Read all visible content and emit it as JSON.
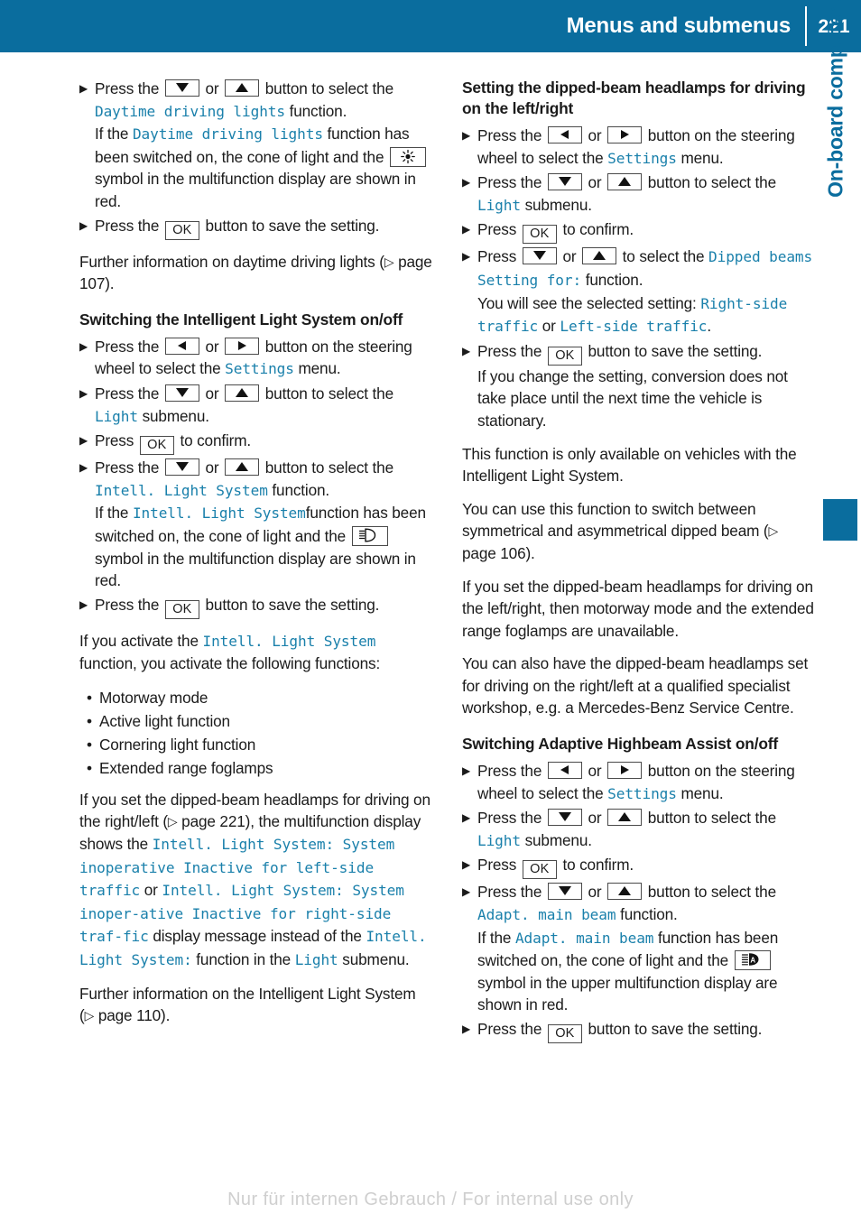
{
  "header": {
    "title": "Menus and submenus",
    "page_number": "221"
  },
  "side_tab": {
    "label": "On-board computer and displays"
  },
  "accent_colors": {
    "header_blue": "#0a6d9e",
    "code_blue": "#1a80ab",
    "body_text": "#1b1b1b",
    "watermark": "#cfcfcf"
  },
  "icons": {
    "step_marker": "play-triangle-icon",
    "bullet_dot": "bullet-dot-icon",
    "ref_arrow": "page-reference-arrow-icon",
    "key_down": "arrow-down-key-icon",
    "key_up": "arrow-up-key-icon",
    "key_left": "arrow-left-key-icon",
    "key_right": "arrow-right-key-icon",
    "key_ok": "ok-key-icon",
    "sym_daytime": "daytime-running-lights-symbol-icon",
    "sym_dipped": "dipped-beam-symbol-icon",
    "sym_adaptive": "adaptive-highbeam-symbol-icon"
  },
  "labels": {
    "ok": "OK",
    "bullet": "•",
    "step_marker": "▶",
    "ref_arrow": "▷"
  },
  "left_column": {
    "step_daytime": {
      "t1": "Press the ",
      "t2": " or ",
      "t3": " button to select the ",
      "code1": "Daytime driving lights",
      "t4": " function.",
      "t5": "If the ",
      "code2": "Daytime driving lights",
      "t6": " function has been switched on, the cone of light and the ",
      "t7": " symbol in the multifunction display are shown in red."
    },
    "step_save_1": {
      "t1": "Press the ",
      "t2": " button to save the setting."
    },
    "para_further_dtl": {
      "t1": "Further information on daytime driving lights (",
      "t2": " page 107)."
    },
    "heading_ils": "Switching the Intelligent Light System on/off",
    "step_settings": {
      "t1": "Press the ",
      "t2": " or ",
      "t3": " button on the steering wheel to select the ",
      "code1": "Settings",
      "t4": " menu."
    },
    "step_light_submenu": {
      "t1": "Press the ",
      "t2": " or ",
      "t3": " button to select the ",
      "code1": "Light",
      "t4": " submenu."
    },
    "step_confirm": {
      "t1": "Press ",
      "t2": " to confirm."
    },
    "step_ils_function": {
      "t1": "Press the ",
      "t2": " or ",
      "t3": " button to select the ",
      "code1": "Intell. Light System",
      "t4": " function.",
      "t5": "If the ",
      "code2": "Intell. Light System",
      "t6": "function has been switched on, the cone of light and the ",
      "t7": " symbol in the multifunction display are shown in red."
    },
    "step_save_2": {
      "t1": "Press the ",
      "t2": " button to save the setting."
    },
    "para_activate": {
      "t1": "If you activate the ",
      "code1": "Intell. Light System",
      "t2": " function, you activate the following functions:"
    },
    "bullets": [
      "Motorway mode",
      "Active light function",
      "Cornering light function",
      "Extended range foglamps"
    ],
    "para_dipped_set": {
      "t1": "If you set the dipped-beam headlamps for driving on the right/left (",
      "t2": " page 221), the multifunction display shows the ",
      "code1": "Intell. Light System: System inoperative Inactive for left-side traffic",
      "t3": " or ",
      "code2": "Intell. Light System: System inoper‑ative Inactive for right-side traf‑fic",
      "t4": " display message instead of the ",
      "code3": "Intell. Light System:",
      "t5": " function in the ",
      "code4": "Light",
      "t6": " submenu."
    },
    "para_further_ils": {
      "t1": "Further information on the Intelligent Light System (",
      "t2": " page 110)."
    }
  },
  "right_column": {
    "heading_dipped": "Setting the dipped-beam headlamps for driving on the left/right",
    "step_settings": {
      "t1": "Press the ",
      "t2": " or ",
      "t3": " button on the steering wheel to select the ",
      "code1": "Settings",
      "t4": " menu."
    },
    "step_light_submenu": {
      "t1": "Press the ",
      "t2": " or ",
      "t3": " button to select the ",
      "code1": "Light",
      "t4": " submenu."
    },
    "step_confirm": {
      "t1": "Press ",
      "t2": " to confirm."
    },
    "step_dipped_setting": {
      "t1": "Press ",
      "t2": " or ",
      "t3": " to select the ",
      "code1": "Dipped beams Setting for:",
      "t4": " function.",
      "t5": "You will see the selected setting: ",
      "code2": "Right-side traffic",
      "t6": " or ",
      "code3": "Left-side traffic",
      "t7": "."
    },
    "step_save": {
      "t1": "Press the ",
      "t2": " button to save the setting.",
      "t3": "If you change the setting, conversion does not take place until the next time the vehicle is stationary."
    },
    "para_only_available": "This function is only available on vehicles with the Intelligent Light System.",
    "para_switch_between": {
      "t1": "You can use this function to switch between symmetrical and asymmetrical dipped beam (",
      "t2": " page 106)."
    },
    "para_motorway": "If you set the dipped-beam headlamps for driving on the left/right, then motorway mode and the extended range foglamps are unavailable.",
    "para_workshop": "You can also have the dipped-beam headlamps set for driving on the right/left at a qualified specialist workshop, e.g. a Mercedes-Benz Service Centre.",
    "heading_adaptive": "Switching Adaptive Highbeam Assist on/off",
    "step_settings2": {
      "t1": "Press the ",
      "t2": " or ",
      "t3": " button on the steering wheel to select the ",
      "code1": "Settings",
      "t4": " menu."
    },
    "step_light_submenu2": {
      "t1": "Press the ",
      "t2": " or ",
      "t3": " button to select the ",
      "code1": "Light",
      "t4": " submenu."
    },
    "step_confirm2": {
      "t1": "Press ",
      "t2": " to confirm."
    },
    "step_adapt": {
      "t1": "Press the ",
      "t2": " or ",
      "t3": " button to select the ",
      "code1": "Adapt. main beam",
      "t4": " function.",
      "t5": "If the ",
      "code2": "Adapt. main beam",
      "t6": " function has been switched on, the cone of light and the ",
      "t7": " symbol in the upper multifunction display are shown in red."
    },
    "step_save2": {
      "t1": "Press the ",
      "t2": " button to save the setting."
    }
  },
  "footer": {
    "watermark": "Nur für internen Gebrauch / For internal use only"
  }
}
